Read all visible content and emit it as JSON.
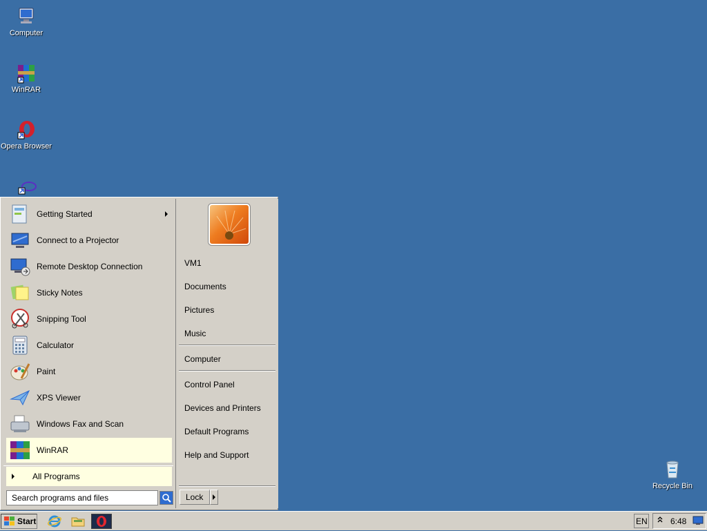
{
  "desktop": {
    "icons": [
      {
        "label": "Computer",
        "icon": "computer-icon"
      },
      {
        "label": "WinRAR",
        "icon": "winrar-icon"
      },
      {
        "label": "Opera Browser",
        "icon": "opera-icon"
      },
      {
        "label": "",
        "icon": "shortcut-icon"
      },
      {
        "label": "Recycle Bin",
        "icon": "recycle-bin-icon"
      }
    ]
  },
  "start_menu": {
    "programs": [
      {
        "label": "Getting Started",
        "icon": "getting-started-icon",
        "has_submenu": true
      },
      {
        "label": "Connect to a Projector",
        "icon": "projector-icon"
      },
      {
        "label": "Remote Desktop Connection",
        "icon": "remote-desktop-icon"
      },
      {
        "label": "Sticky Notes",
        "icon": "sticky-notes-icon"
      },
      {
        "label": "Snipping Tool",
        "icon": "snipping-tool-icon"
      },
      {
        "label": "Calculator",
        "icon": "calculator-icon"
      },
      {
        "label": "Paint",
        "icon": "paint-icon"
      },
      {
        "label": "XPS Viewer",
        "icon": "xps-viewer-icon"
      },
      {
        "label": "Windows Fax and Scan",
        "icon": "fax-scan-icon"
      },
      {
        "label": "WinRAR",
        "icon": "winrar-icon",
        "highlighted": true
      }
    ],
    "all_programs": "All Programs",
    "search_placeholder": "Search programs and files",
    "right": {
      "group1": [
        "VM1",
        "Documents",
        "Pictures",
        "Music"
      ],
      "group2": [
        "Computer"
      ],
      "group3": [
        "Control Panel",
        "Devices and Printers",
        "Default Programs",
        "Help and Support"
      ]
    },
    "lock_label": "Lock"
  },
  "taskbar": {
    "start_label": "Start",
    "language": "EN",
    "clock": "6:48"
  },
  "colors": {
    "desktop": "#3a6ea5",
    "menu": "#d4d0c8",
    "highlight": "#ffffe1"
  }
}
